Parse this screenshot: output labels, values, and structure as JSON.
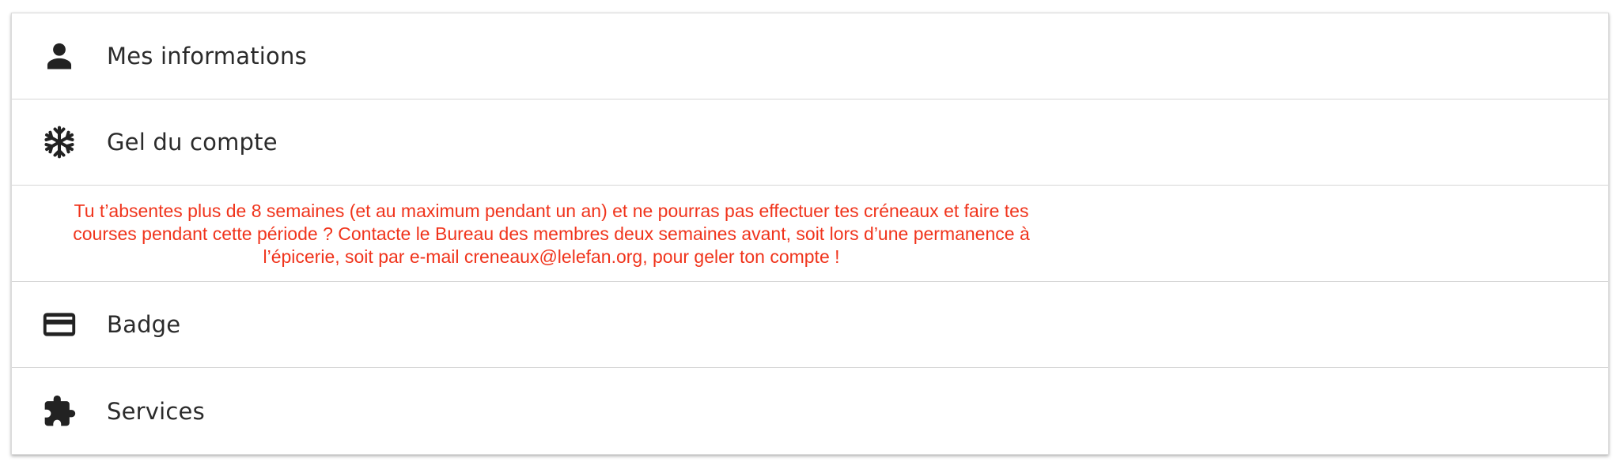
{
  "menu": {
    "items": [
      {
        "label": "Mes informations",
        "icon": "person-icon"
      },
      {
        "label": "Gel du compte",
        "icon": "snowflake-icon"
      },
      {
        "label": "Badge",
        "icon": "credit-card-icon"
      },
      {
        "label": "Services",
        "icon": "puzzle-icon"
      }
    ]
  },
  "freeze_notice": {
    "text": "Tu t’absentes plus de 8 semaines (et au maximum pendant un an) et ne pourras pas effectuer tes créneaux et faire tes courses pendant cette période ? Contacte le Bureau des membres deux semaines avant, soit lors d’une permanence à l’épicerie, soit par e-mail creneaux@lelefan.org, pour geler ton compte !"
  },
  "colors": {
    "notice_text": "#f0341c",
    "label_text": "#2b2b2b",
    "icon": "#222222",
    "divider": "#d6d6d6"
  }
}
